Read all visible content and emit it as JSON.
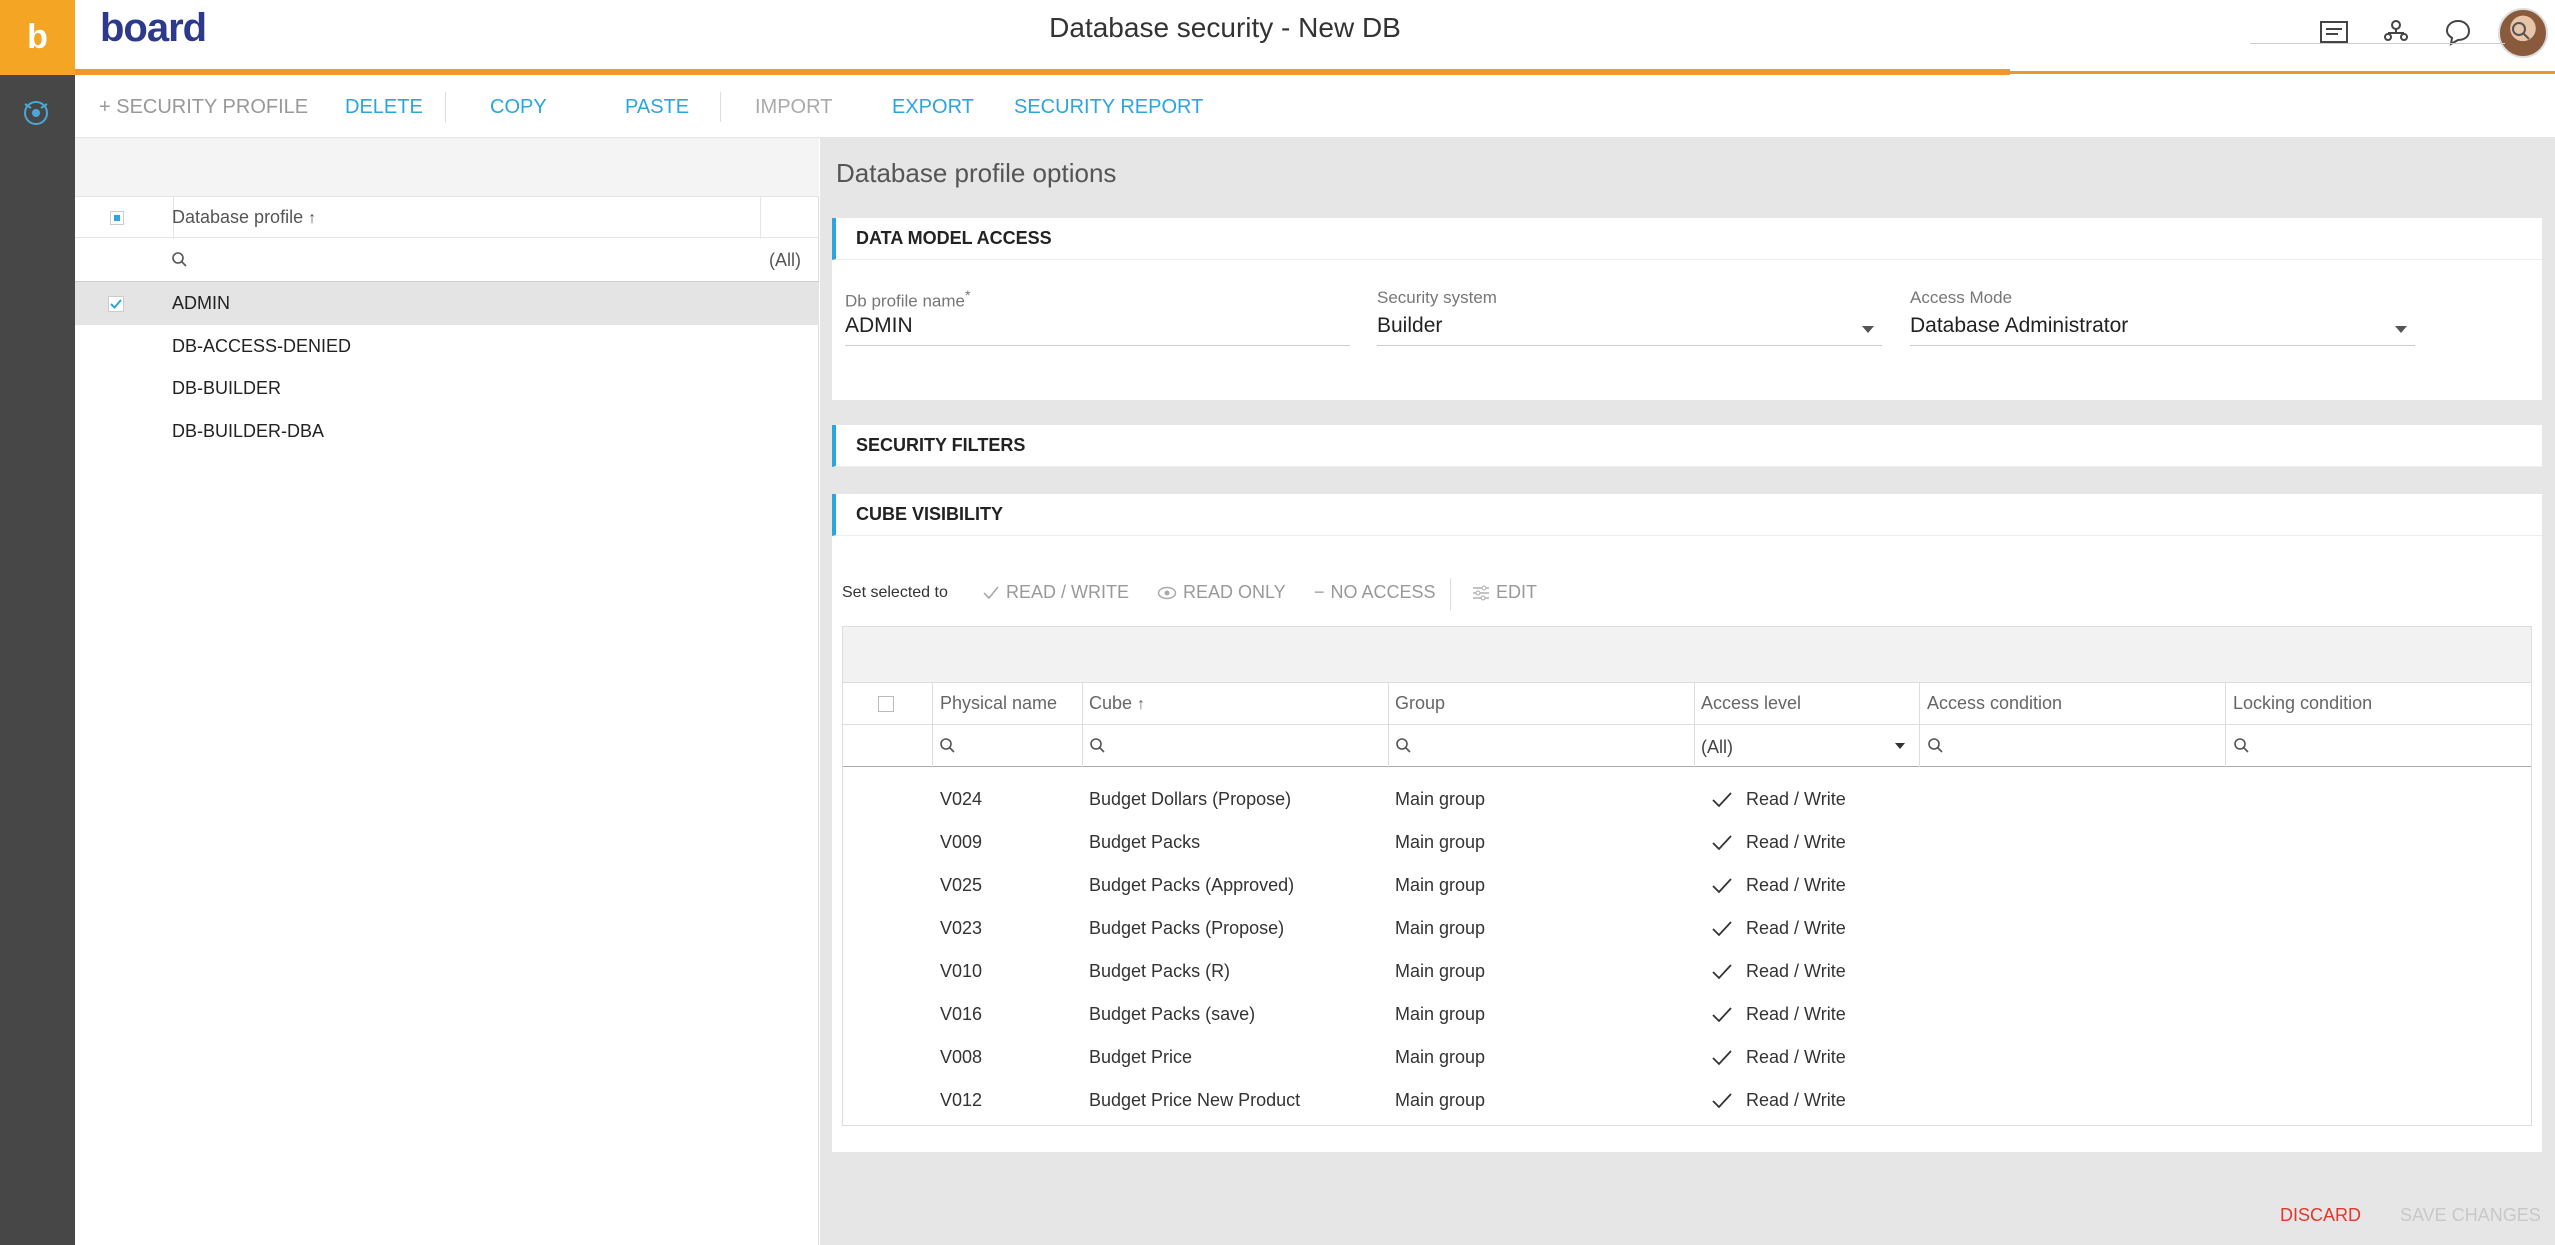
{
  "app": {
    "brand": "board",
    "title": "Database security - New DB"
  },
  "colors": {
    "accent": "#2ba5e0",
    "brand_orange": "#f5a524",
    "danger": "#e0382b"
  },
  "header": {
    "icons": [
      "presentation-icon",
      "user-group-icon",
      "chat-icon"
    ]
  },
  "toolbar": {
    "security_profile": "+  SECURITY PROFILE",
    "delete": "DELETE",
    "copy": "COPY",
    "paste": "PASTE",
    "import": "IMPORT",
    "export": "EXPORT",
    "security_report": "SECURITY REPORT"
  },
  "left": {
    "column_header": "Database profile",
    "filter_all": "(All)",
    "profiles": [
      "ADMIN",
      "DB-ACCESS-DENIED",
      "DB-BUILDER",
      "DB-BUILDER-DBA"
    ]
  },
  "right": {
    "title": "Database profile options",
    "data_model_access": {
      "heading": "DATA MODEL ACCESS",
      "db_profile_name_label": "Db profile name",
      "db_profile_name_required": "*",
      "db_profile_name": "ADMIN",
      "security_system_label": "Security system",
      "security_system": "Builder",
      "access_mode_label": "Access Mode",
      "access_mode": "Database Administrator"
    },
    "security_filters": {
      "heading": "SECURITY FILTERS"
    },
    "cube_visibility": {
      "heading": "CUBE VISIBILITY",
      "set_selected_to": "Set selected to",
      "read_write": "READ / WRITE",
      "read_only": "READ ONLY",
      "no_access": "NO ACCESS",
      "edit": "EDIT",
      "columns": [
        "Physical name",
        "Cube",
        "Group",
        "Access level",
        "Access condition",
        "Locking condition"
      ],
      "access_filter_all": "(All)",
      "rows": [
        {
          "physical": "V024",
          "cube": "Budget Dollars (Propose)",
          "group": "Main group",
          "access": "Read / Write"
        },
        {
          "physical": "V009",
          "cube": "Budget Packs",
          "group": "Main group",
          "access": "Read / Write"
        },
        {
          "physical": "V025",
          "cube": "Budget Packs (Approved)",
          "group": "Main group",
          "access": "Read / Write"
        },
        {
          "physical": "V023",
          "cube": "Budget Packs (Propose)",
          "group": "Main group",
          "access": "Read / Write"
        },
        {
          "physical": "V010",
          "cube": "Budget Packs (R)",
          "group": "Main group",
          "access": "Read / Write"
        },
        {
          "physical": "V016",
          "cube": "Budget Packs (save)",
          "group": "Main group",
          "access": "Read / Write"
        },
        {
          "physical": "V008",
          "cube": "Budget Price",
          "group": "Main group",
          "access": "Read / Write"
        },
        {
          "physical": "V012",
          "cube": "Budget Price New Product",
          "group": "Main group",
          "access": "Read / Write"
        }
      ]
    }
  },
  "footer": {
    "discard": "DISCARD",
    "save": "SAVE CHANGES"
  }
}
